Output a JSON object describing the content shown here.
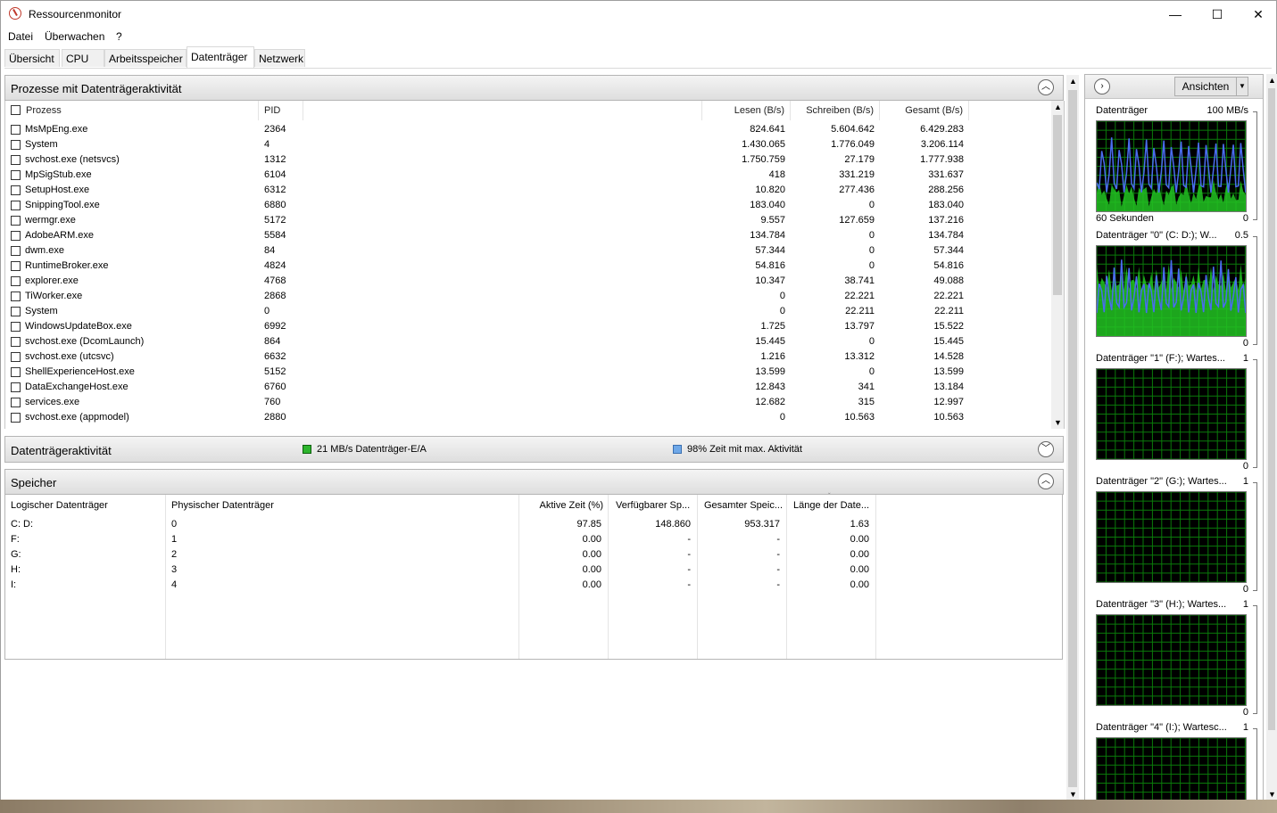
{
  "window": {
    "title": "Ressourcenmonitor",
    "minimize": "—",
    "maximize": "☐",
    "close": "✕"
  },
  "menu": [
    "Datei",
    "Überwachen",
    "?"
  ],
  "tabs": [
    "Übersicht",
    "CPU",
    "Arbeitsspeicher",
    "Datenträger",
    "Netzwerk"
  ],
  "active_tab": "Datenträger",
  "processes": {
    "title": "Prozesse mit Datenträgeraktivität",
    "columns": [
      "Prozess",
      "PID",
      "Lesen (B/s)",
      "Schreiben (B/s)",
      "Gesamt (B/s)"
    ],
    "rows": [
      [
        "MsMpEng.exe",
        "2364",
        "824.641",
        "5.604.642",
        "6.429.283"
      ],
      [
        "System",
        "4",
        "1.430.065",
        "1.776.049",
        "3.206.114"
      ],
      [
        "svchost.exe (netsvcs)",
        "1312",
        "1.750.759",
        "27.179",
        "1.777.938"
      ],
      [
        "MpSigStub.exe",
        "6104",
        "418",
        "331.219",
        "331.637"
      ],
      [
        "SetupHost.exe",
        "6312",
        "10.820",
        "277.436",
        "288.256"
      ],
      [
        "SnippingTool.exe",
        "6880",
        "183.040",
        "0",
        "183.040"
      ],
      [
        "wermgr.exe",
        "5172",
        "9.557",
        "127.659",
        "137.216"
      ],
      [
        "AdobeARM.exe",
        "5584",
        "134.784",
        "0",
        "134.784"
      ],
      [
        "dwm.exe",
        "84",
        "57.344",
        "0",
        "57.344"
      ],
      [
        "RuntimeBroker.exe",
        "4824",
        "54.816",
        "0",
        "54.816"
      ],
      [
        "explorer.exe",
        "4768",
        "10.347",
        "38.741",
        "49.088"
      ],
      [
        "TiWorker.exe",
        "2868",
        "0",
        "22.221",
        "22.221"
      ],
      [
        "System",
        "0",
        "0",
        "22.211",
        "22.211"
      ],
      [
        "WindowsUpdateBox.exe",
        "6992",
        "1.725",
        "13.797",
        "15.522"
      ],
      [
        "svchost.exe (DcomLaunch)",
        "864",
        "15.445",
        "0",
        "15.445"
      ],
      [
        "svchost.exe (utcsvc)",
        "6632",
        "1.216",
        "13.312",
        "14.528"
      ],
      [
        "ShellExperienceHost.exe",
        "5152",
        "13.599",
        "0",
        "13.599"
      ],
      [
        "DataExchangeHost.exe",
        "6760",
        "12.843",
        "341",
        "13.184"
      ],
      [
        "services.exe",
        "760",
        "12.682",
        "315",
        "12.997"
      ],
      [
        "svchost.exe (appmodel)",
        "2880",
        "0",
        "10.563",
        "10.563"
      ]
    ]
  },
  "activity": {
    "title": "Datenträgeraktivität",
    "io": "21 MB/s Datenträger-E/A",
    "busy": "98% Zeit mit max. Aktivität",
    "io_color": "#2db52d",
    "busy_color": "#6fa8e8"
  },
  "storage": {
    "title": "Speicher",
    "columns": [
      "Logischer Datenträger",
      "Physischer Datenträger",
      "Aktive Zeit (%)",
      "Verfügbarer Sp...",
      "Gesamter Speic...",
      "Länge der Date..."
    ],
    "rows": [
      [
        "C: D:",
        "0",
        "97.85",
        "148.860",
        "953.317",
        "1.63"
      ],
      [
        "F:",
        "1",
        "0.00",
        "-",
        "-",
        "0.00"
      ],
      [
        "G:",
        "2",
        "0.00",
        "-",
        "-",
        "0.00"
      ],
      [
        "H:",
        "3",
        "0.00",
        "-",
        "-",
        "0.00"
      ],
      [
        "I:",
        "4",
        "0.00",
        "-",
        "-",
        "0.00"
      ]
    ]
  },
  "sidepanel": {
    "expand_icon": "chevron-right-icon",
    "view_button": "Ansichten",
    "graphs": [
      {
        "label": "Datenträger",
        "max": "100 MB/s",
        "footer_left": "60 Sekunden",
        "footer_right": "0",
        "active": true
      },
      {
        "label": "Datenträger \"0\" (C: D:); W...",
        "max": "0.5",
        "footer_left": "",
        "footer_right": "0",
        "active": true
      },
      {
        "label": "Datenträger \"1\" (F:); Wartes...",
        "max": "1",
        "footer_left": "",
        "footer_right": "0",
        "active": false
      },
      {
        "label": "Datenträger \"2\" (G:); Wartes...",
        "max": "1",
        "footer_left": "",
        "footer_right": "0",
        "active": false
      },
      {
        "label": "Datenträger \"3\" (H:); Wartes...",
        "max": "1",
        "footer_left": "",
        "footer_right": "0",
        "active": false
      },
      {
        "label": "Datenträger \"4\" (I:); Wartesc...",
        "max": "1",
        "footer_left": "",
        "footer_right": "",
        "active": false
      }
    ]
  }
}
